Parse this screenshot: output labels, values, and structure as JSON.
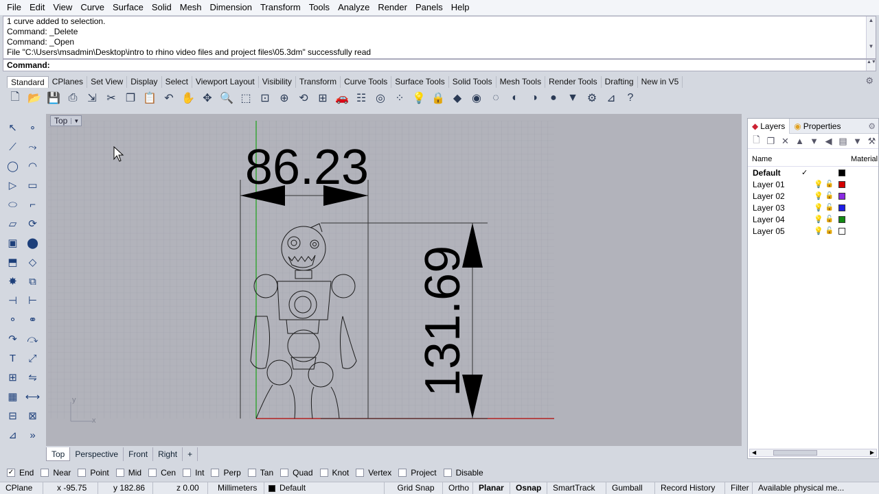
{
  "menu": [
    "File",
    "Edit",
    "View",
    "Curve",
    "Surface",
    "Solid",
    "Mesh",
    "Dimension",
    "Transform",
    "Tools",
    "Analyze",
    "Render",
    "Panels",
    "Help"
  ],
  "history": [
    "1 curve added to selection.",
    "Command: _Delete",
    "Command: _Open",
    "File \"C:\\Users\\msadmin\\Desktop\\intro to rhino video files and project files\\05.3dm\" successfully read"
  ],
  "command_label": "Command:",
  "toolbar_tabs": [
    "Standard",
    "CPlanes",
    "Set View",
    "Display",
    "Select",
    "Viewport Layout",
    "Visibility",
    "Transform",
    "Curve Tools",
    "Surface Tools",
    "Solid Tools",
    "Mesh Tools",
    "Render Tools",
    "Drafting",
    "New in V5"
  ],
  "toolbar_icons": [
    "new-icon",
    "open-icon",
    "save-icon",
    "print-icon",
    "import-icon",
    "cut-icon",
    "copy-icon",
    "paste-icon",
    "undo-icon",
    "pan-icon",
    "rotate-icon",
    "zoom-icon",
    "zoom-window-icon",
    "zoom-extents-icon",
    "zoom-selected-icon",
    "rotate-view-icon",
    "four-viewports-icon",
    "car-icon",
    "properties-icon",
    "osnap-icon",
    "points-icon",
    "light-icon",
    "lock-icon",
    "layer-icon",
    "color-wheel-icon",
    "wireframe-sphere-icon",
    "shaded-sphere-icon",
    "rendered-sphere-icon",
    "render-sphere-icon",
    "render-icon",
    "settings-icon",
    "analyze-icon",
    "help-icon"
  ],
  "left_tools": [
    "select-arrow-icon",
    "point-icon",
    "polyline-icon",
    "curve-point-icon",
    "circle-icon",
    "arc-icon",
    "polygon-icon",
    "rectangle-icon",
    "ellipse-icon",
    "fillet-icon",
    "surface-icon",
    "revolve-icon",
    "box-icon",
    "sphere-icon",
    "extrude-icon",
    "loft-icon",
    "explode-icon",
    "boolean-icon",
    "trim-icon",
    "split-icon",
    "group-icon",
    "ungroup-icon",
    "offset-icon",
    "blend-icon",
    "text-icon",
    "scale-icon",
    "array-icon",
    "mirror-icon",
    "mesh-icon",
    "dimension-icon",
    "grid-array-icon",
    "layout-icon",
    "analyze-icon",
    "more-icon"
  ],
  "viewport": {
    "title": "Top",
    "dim_h": "86.23",
    "dim_v": "131.69",
    "axis_x": "x",
    "axis_y": "y"
  },
  "viewport_tabs": [
    "Top",
    "Perspective",
    "Front",
    "Right"
  ],
  "panel": {
    "tabs": [
      "Layers",
      "Properties"
    ],
    "header_name": "Name",
    "header_material": "Material",
    "layers": [
      {
        "name": "Default",
        "current": "✓",
        "color": "#000000",
        "bold": true
      },
      {
        "name": "Layer 01",
        "current": "",
        "color": "#d40000",
        "bold": false
      },
      {
        "name": "Layer 02",
        "current": "",
        "color": "#8a2be2",
        "bold": false
      },
      {
        "name": "Layer 03",
        "current": "",
        "color": "#1e1ee6",
        "bold": false
      },
      {
        "name": "Layer 04",
        "current": "",
        "color": "#138a13",
        "bold": false
      },
      {
        "name": "Layer 05",
        "current": "",
        "color": "#ffffff",
        "bold": false
      }
    ]
  },
  "osnaps": [
    {
      "label": "End",
      "checked": true
    },
    {
      "label": "Near",
      "checked": false
    },
    {
      "label": "Point",
      "checked": false
    },
    {
      "label": "Mid",
      "checked": false
    },
    {
      "label": "Cen",
      "checked": false
    },
    {
      "label": "Int",
      "checked": false
    },
    {
      "label": "Perp",
      "checked": false
    },
    {
      "label": "Tan",
      "checked": false
    },
    {
      "label": "Quad",
      "checked": false
    },
    {
      "label": "Knot",
      "checked": false
    },
    {
      "label": "Vertex",
      "checked": false
    },
    {
      "label": "Project",
      "checked": false
    },
    {
      "label": "Disable",
      "checked": false
    }
  ],
  "status": {
    "cplane": "CPlane",
    "x": "x -95.75",
    "y": "y 182.86",
    "z": "z 0.00",
    "units": "Millimeters",
    "layer": "Default",
    "grid_snap": "Grid Snap",
    "ortho": "Ortho",
    "planar": "Planar",
    "osnap": "Osnap",
    "smarttrack": "SmartTrack",
    "gumball": "Gumball",
    "record_history": "Record History",
    "filter": "Filter",
    "available": "Available physical me..."
  }
}
